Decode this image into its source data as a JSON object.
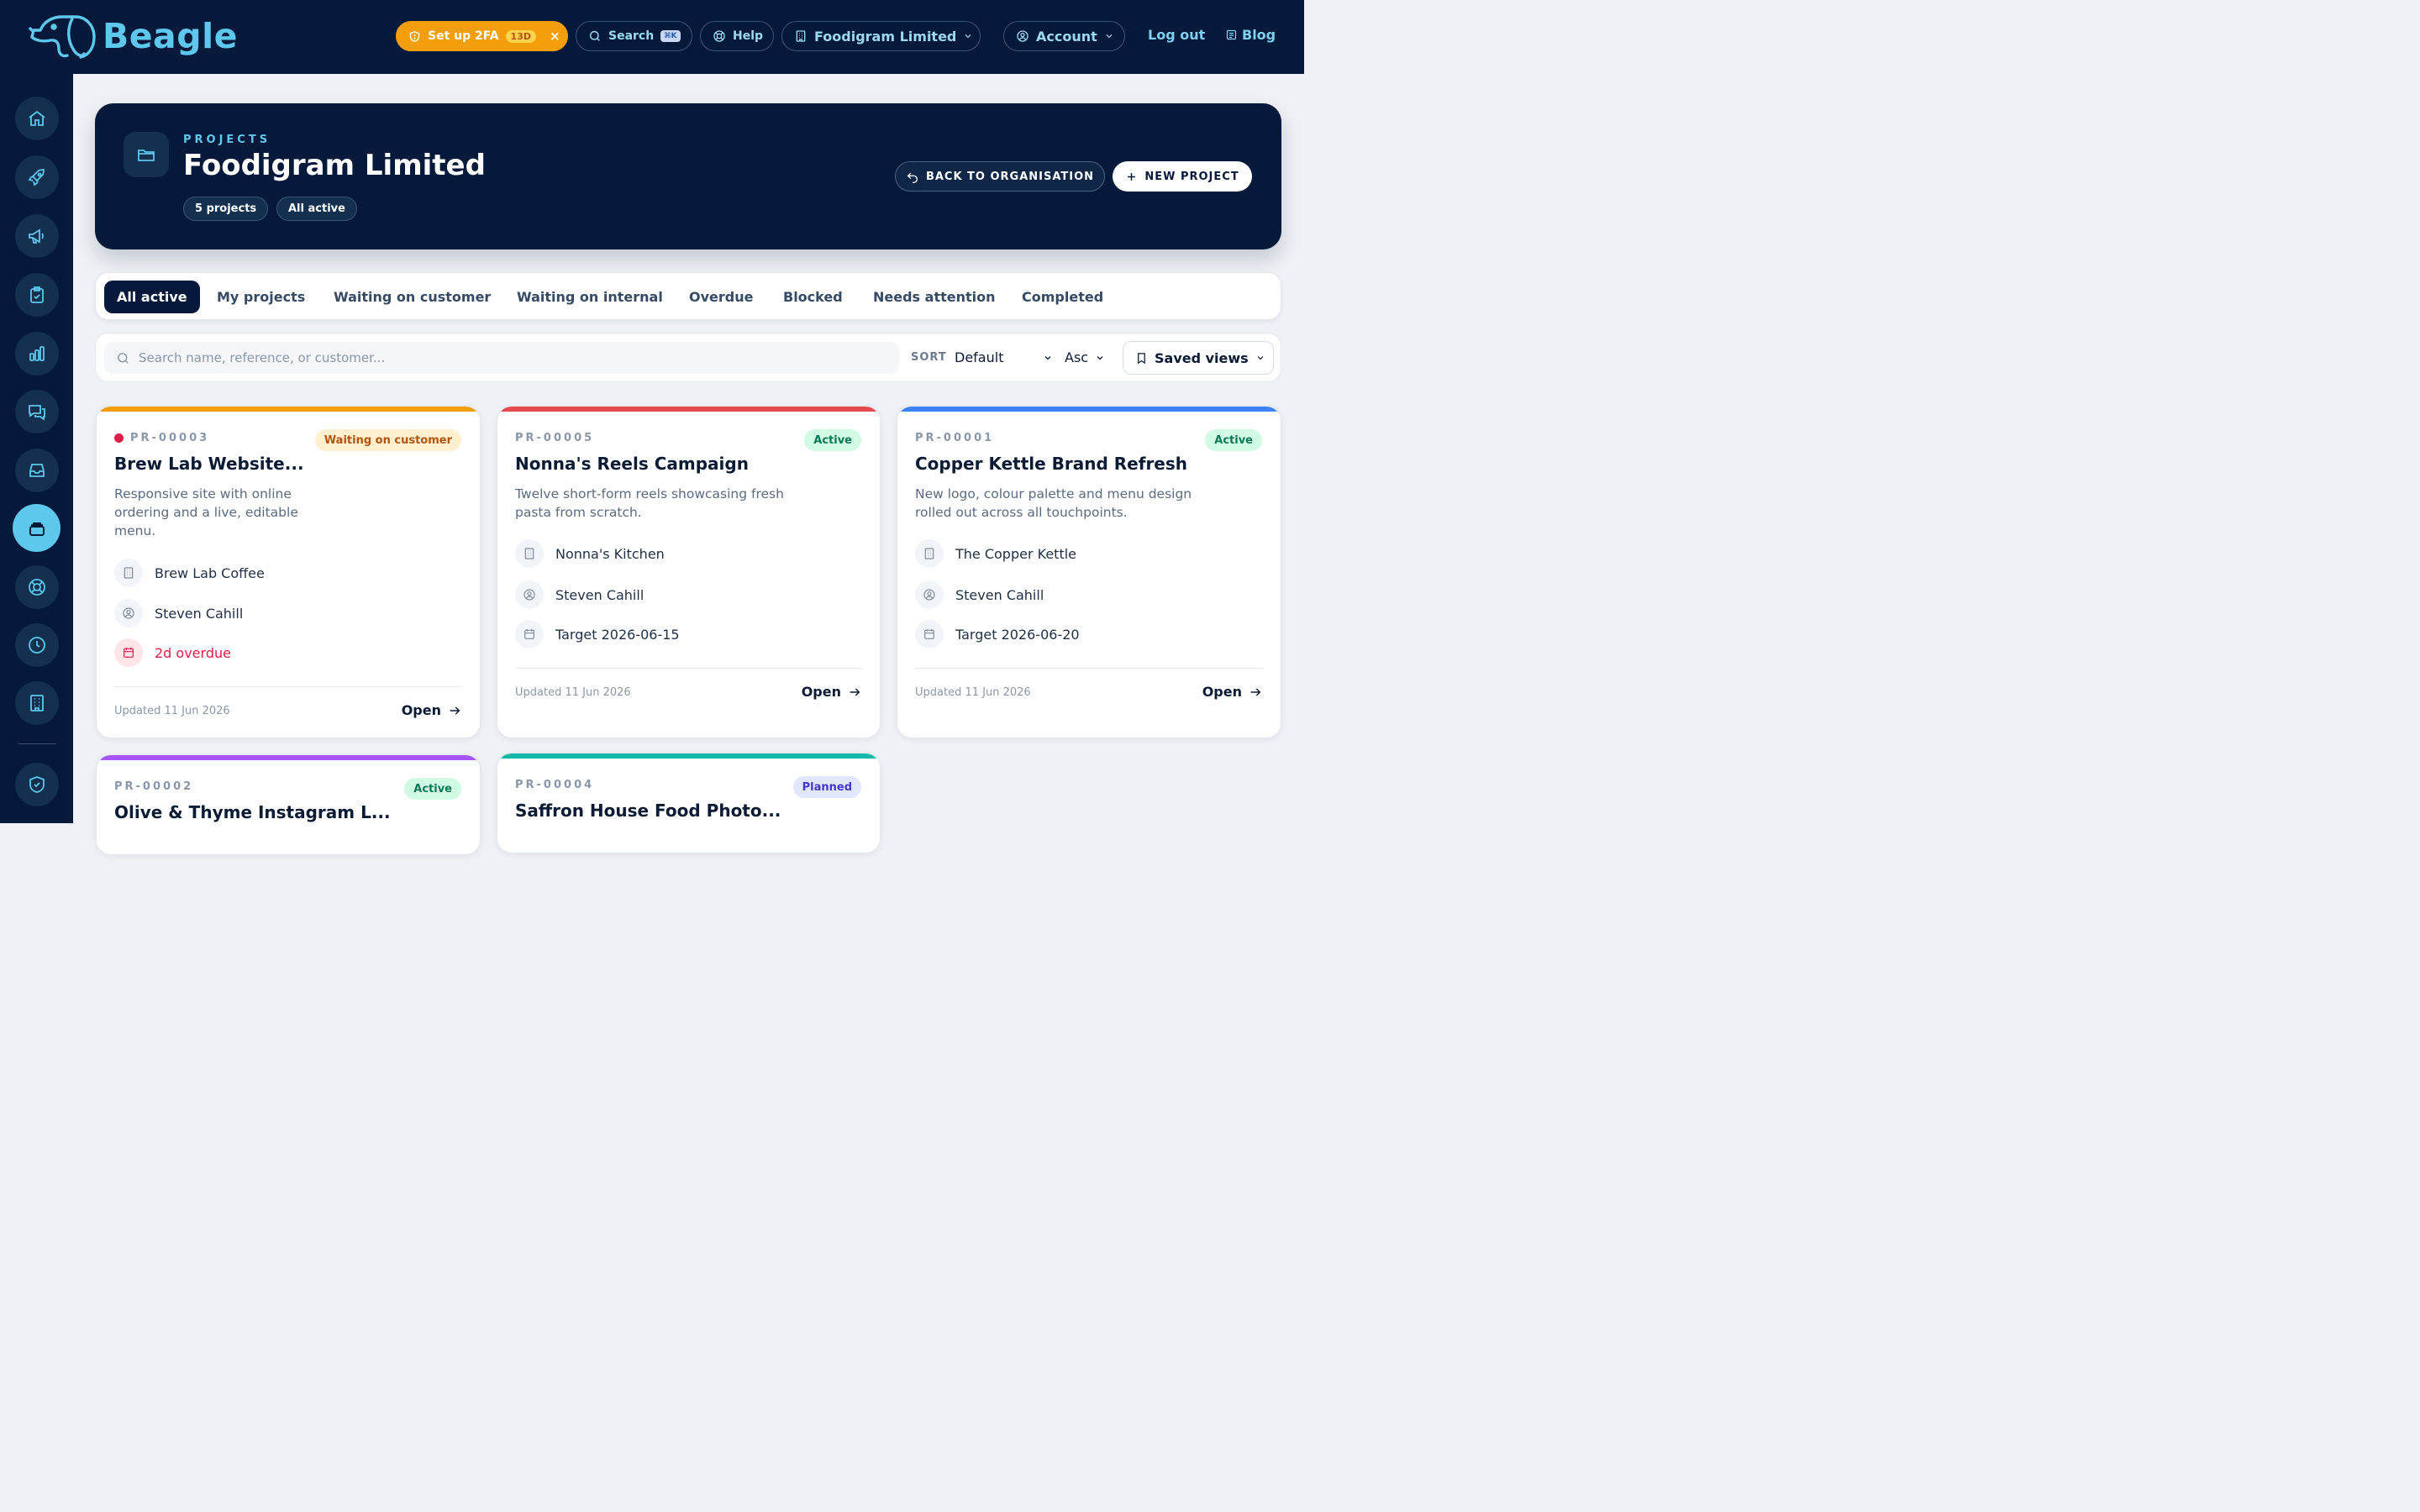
{
  "topbar": {
    "brand": "Beagle",
    "twofa_label": "Set up 2FA",
    "twofa_days": "13D",
    "twofa_close": "×",
    "search_label": "Search",
    "search_shortcut": "⌘K",
    "help_label": "Help",
    "org_label": "Foodigram Limited",
    "account_label": "Account",
    "logout_label": "Log out",
    "blog_label": "Blog"
  },
  "hero": {
    "kicker": "PROJECTS",
    "title": "Foodigram Limited",
    "chip_count": "5 projects",
    "chip_status": "All active",
    "back_label": "BACK TO ORGANISATION",
    "new_label": "NEW PROJECT"
  },
  "tabs": [
    "All active",
    "My projects",
    "Waiting on customer",
    "Waiting on internal",
    "Overdue",
    "Blocked",
    "Needs attention",
    "Completed"
  ],
  "filters": {
    "search_placeholder": "Search name, reference, or customer...",
    "sort_label": "SORT",
    "sort_value": "Default",
    "sort_dir": "Asc",
    "saved_views": "Saved views"
  },
  "colors": {
    "navy": "#051a3a",
    "accent": "#5ec7ec",
    "orange": "#f59e0b",
    "red": "#e5484d",
    "blue": "#3b82f6",
    "purple": "#a855f7",
    "teal": "#14b8a6"
  },
  "cards": [
    {
      "ref": "PR-00003",
      "status": "Waiting on customer",
      "title": "Brew Lab Website...",
      "desc_lines": [
        "Responsive site with online",
        "ordering and a live, editable",
        "menu."
      ],
      "customer": "Brew Lab Coffee",
      "owner": "Steven Cahill",
      "date": "2d overdue",
      "updated": "Updated 11 Jun 2026",
      "open": "Open"
    },
    {
      "ref": "PR-00005",
      "status": "Active",
      "title": "Nonna's Reels Campaign",
      "desc_lines": [
        "Twelve short-form reels showcasing fresh",
        "pasta from scratch."
      ],
      "customer": "Nonna's Kitchen",
      "owner": "Steven Cahill",
      "date": "Target 2026-06-15",
      "updated": "Updated 11 Jun 2026",
      "open": "Open"
    },
    {
      "ref": "PR-00001",
      "status": "Active",
      "title": "Copper Kettle Brand Refresh",
      "desc_lines": [
        "New logo, colour palette and menu design",
        "rolled out across all touchpoints."
      ],
      "customer": "The Copper Kettle",
      "owner": "Steven Cahill",
      "date": "Target 2026-06-20",
      "updated": "Updated 11 Jun 2026",
      "open": "Open"
    },
    {
      "ref": "PR-00002",
      "status": "Active",
      "title": "Olive & Thyme Instagram L..."
    },
    {
      "ref": "PR-00004",
      "status": "Planned",
      "title": "Saffron House Food Photo..."
    }
  ]
}
